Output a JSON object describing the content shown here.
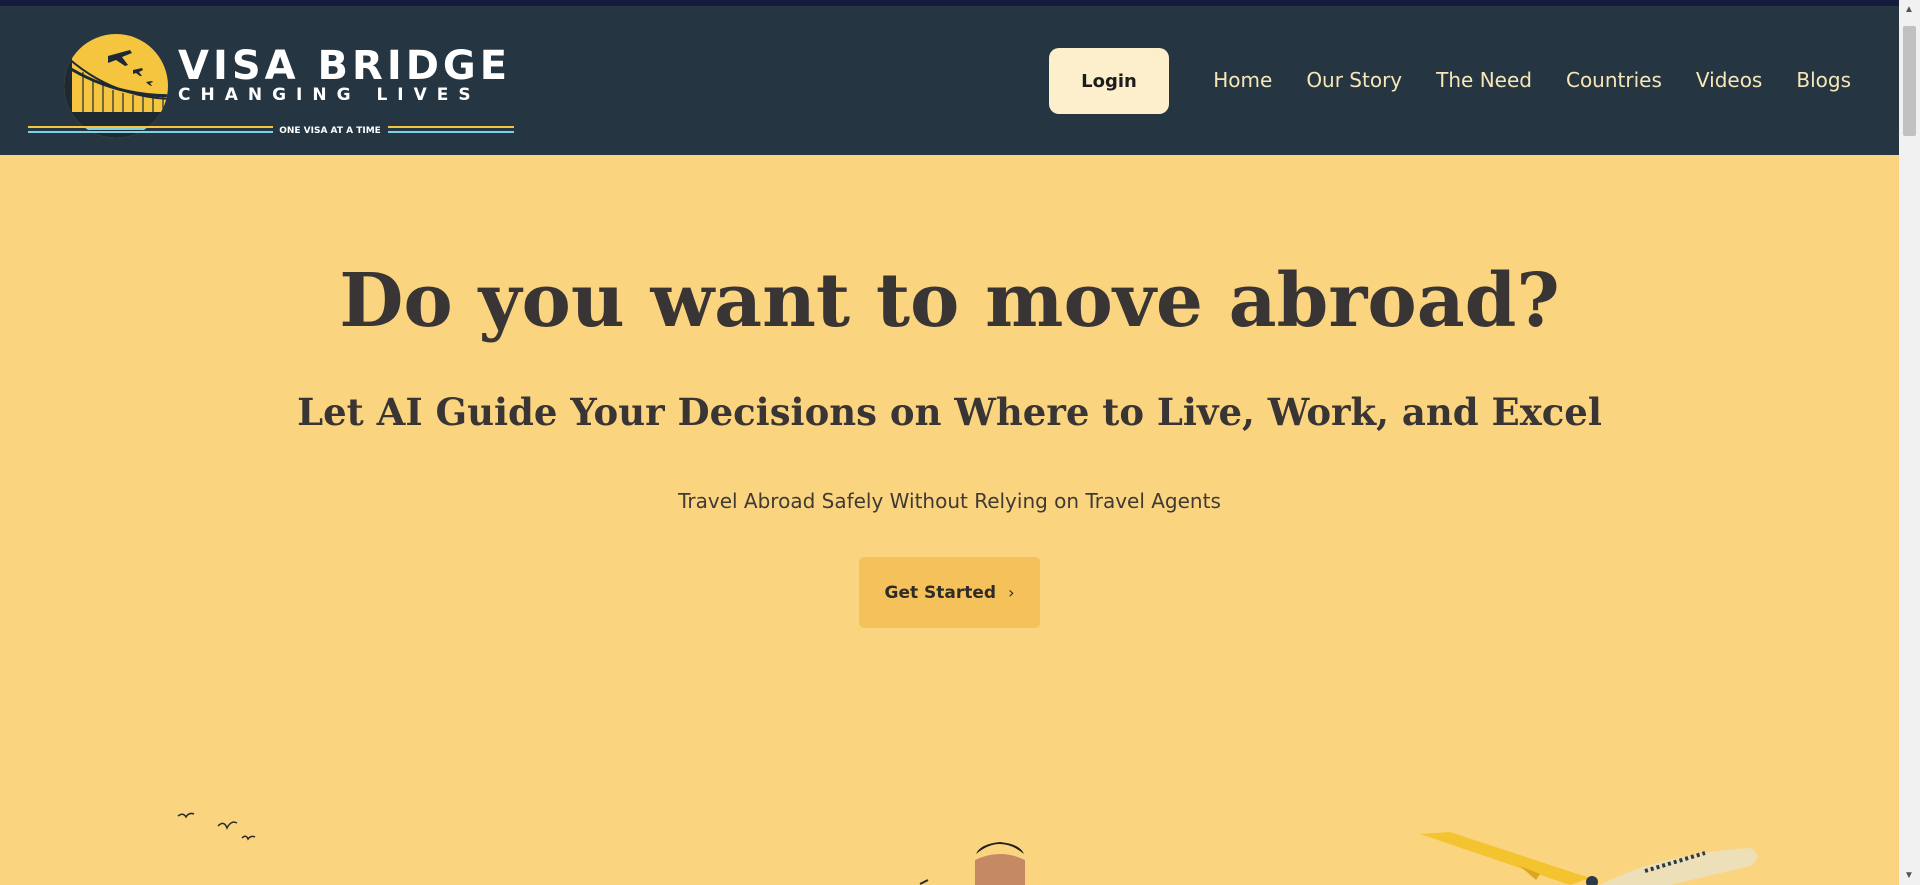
{
  "brand": {
    "name": "VISA BRIDGE",
    "tagline": "CHANGING LIVES",
    "motto": "ONE VISA AT A TIME",
    "colors": {
      "navbar_bg": "#253642",
      "accent_yellow": "#f5c15a",
      "hero_bg": "#fbd480"
    }
  },
  "navbar": {
    "login_label": "Login",
    "links": [
      {
        "label": "Home"
      },
      {
        "label": "Our Story"
      },
      {
        "label": "The Need"
      },
      {
        "label": "Countries"
      },
      {
        "label": "Videos"
      },
      {
        "label": "Blogs"
      }
    ]
  },
  "hero": {
    "title": "Do you want to move abroad?",
    "subtitle": "Let AI Guide Your Decisions on Where to Live, Work, and Excel",
    "tagline": "Travel Abroad Safely Without Relying on Travel Agents",
    "cta_label": "Get Started",
    "cta_icon": "chevron-right-icon"
  },
  "illustration": {
    "elements": [
      "birds-icon",
      "person-figure",
      "airplane-icon"
    ]
  }
}
